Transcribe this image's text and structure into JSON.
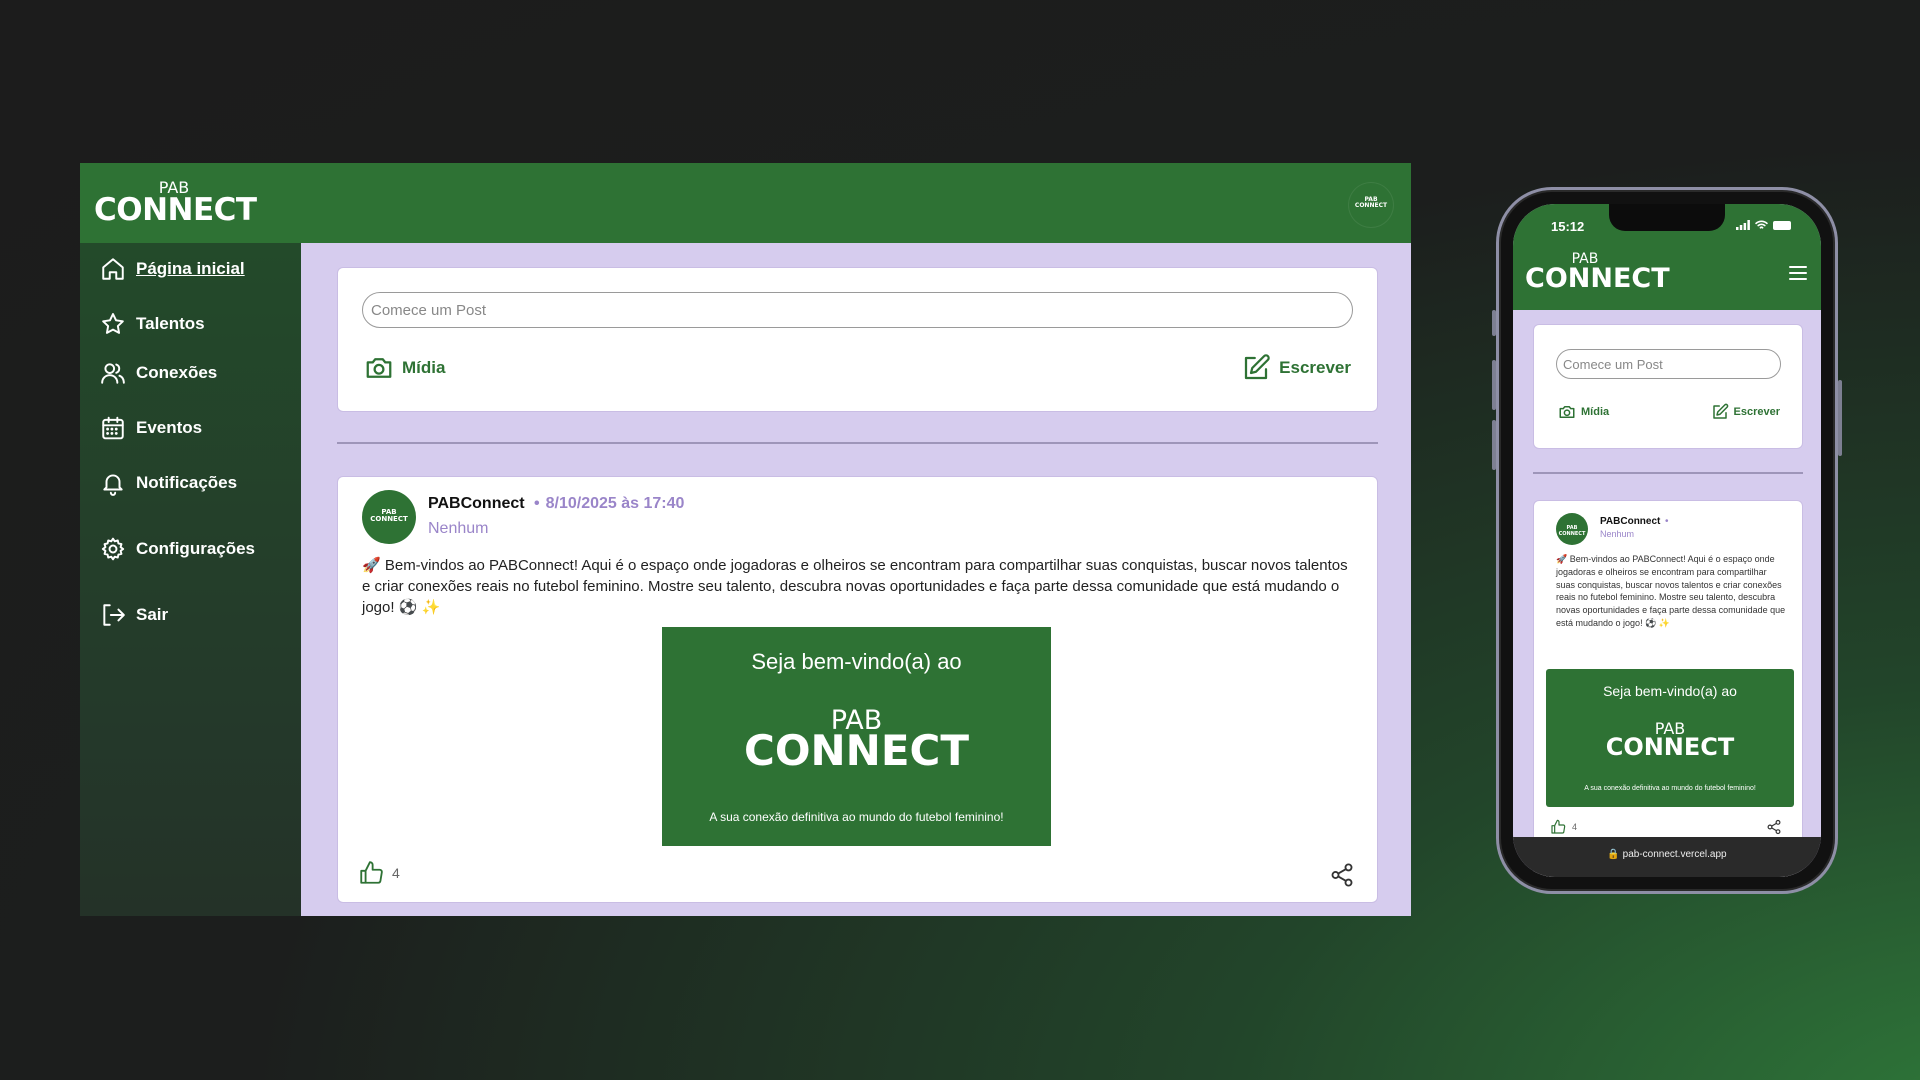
{
  "brand": {
    "pab": "PAB",
    "connect": "CONNECT",
    "avatar_text": "PAB CONNECT"
  },
  "sidebar": {
    "items": [
      {
        "label": "Página inicial",
        "icon": "home-icon"
      },
      {
        "label": "Talentos",
        "icon": "star-icon"
      },
      {
        "label": "Conexões",
        "icon": "users-icon"
      },
      {
        "label": "Eventos",
        "icon": "calendar-icon"
      },
      {
        "label": "Notificações",
        "icon": "bell-icon"
      },
      {
        "label": "Configurações",
        "icon": "gear-icon"
      },
      {
        "label": "Sair",
        "icon": "logout-icon"
      }
    ]
  },
  "composer": {
    "placeholder": "Comece um Post",
    "media_label": "Mídia",
    "write_label": "Escrever"
  },
  "post": {
    "author": "PABConnect",
    "date": "8/10/2025 às 17:40",
    "role": "Nenhum",
    "text": "🚀 Bem-vindos ao PABConnect! Aqui é o espaço onde jogadoras e olheiros se encontram para compartilhar suas conquistas, buscar novos talentos e criar conexões reais no futebol feminino. Mostre seu talento, descubra novas oportunidades e faça parte dessa comunidade que está mudando o jogo! ⚽ ✨",
    "image": {
      "welcome": "Seja bem-vindo(a) ao",
      "pab": "PAB",
      "connect": "CONNECT",
      "tagline": "A sua conexão definitiva ao mundo do futebol feminino!"
    },
    "likes": "4"
  },
  "phone": {
    "time": "15:12",
    "url": "🔒 pab-connect.vercel.app"
  },
  "colors": {
    "brand_green": "#2e7234",
    "lavender_bg": "#d6ccee",
    "accent_purple": "#9a85c9"
  }
}
